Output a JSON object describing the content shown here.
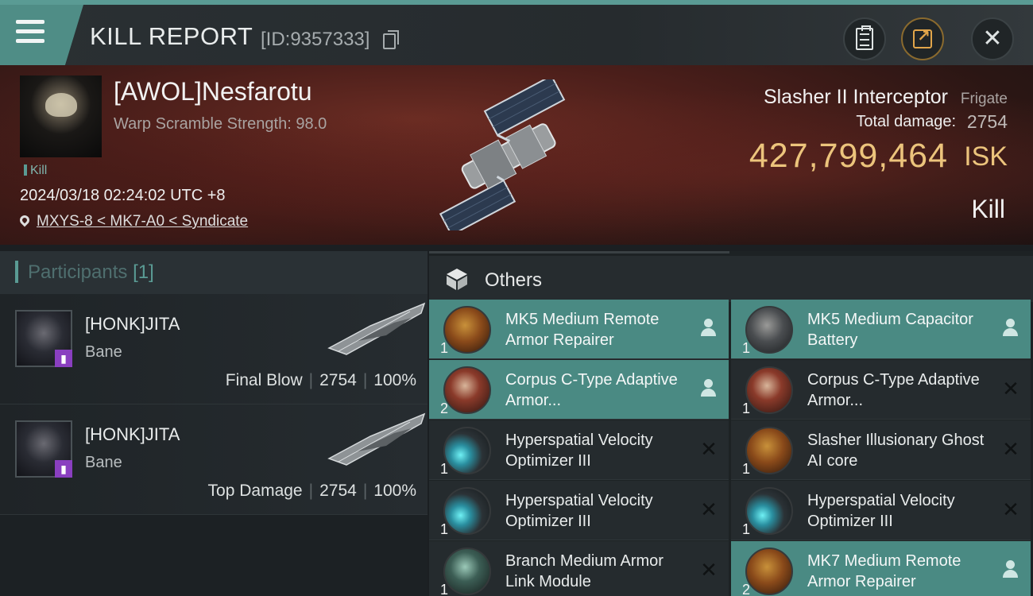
{
  "header": {
    "title": "KILL REPORT",
    "report_id": "[ID:9357333]"
  },
  "victim": {
    "name": "[AWOL]Nesfarotu",
    "scramble": "Warp Scramble Strength: 98.0",
    "tag": "Kill",
    "datetime": "2024/03/18 02:24:02 UTC +8",
    "location": "MXYS-8 < MK7-A0 < Syndicate"
  },
  "ship": {
    "name": "Slasher II Interceptor",
    "class": "Frigate",
    "damage_label": "Total damage:",
    "damage_value": "2754",
    "isk_value": "427,799,464",
    "isk_unit": "ISK",
    "result": "Kill"
  },
  "participants": {
    "label": "Participants",
    "count": "[1]",
    "rows": [
      {
        "name": "[HONK]JITA",
        "ship": "Bane",
        "role": "Final Blow",
        "damage": "2754",
        "percent": "100%"
      },
      {
        "name": "[HONK]JITA",
        "ship": "Bane",
        "role": "Top Damage",
        "damage": "2754",
        "percent": "100%"
      }
    ]
  },
  "others": {
    "label": "Others",
    "items": [
      {
        "qty": "1",
        "name": "MK5 Medium Remote Armor Repairer",
        "status": "fitted-person",
        "icon": "remote-repairer-icon"
      },
      {
        "qty": "1",
        "name": "MK5 Medium Capacitor Battery",
        "status": "fitted-person",
        "icon": "capacitor-battery-icon"
      },
      {
        "qty": "2",
        "name": "Corpus C-Type Adaptive Armor...",
        "status": "fitted-person",
        "icon": "adaptive-armor-icon"
      },
      {
        "qty": "1",
        "name": "Corpus C-Type Adaptive Armor...",
        "status": "destroyed",
        "icon": "adaptive-armor-icon"
      },
      {
        "qty": "1",
        "name": "Hyperspatial Velocity Optimizer III",
        "status": "destroyed",
        "icon": "velocity-optimizer-icon"
      },
      {
        "qty": "1",
        "name": "Slasher Illusionary Ghost AI core",
        "status": "destroyed",
        "icon": "ai-core-icon"
      },
      {
        "qty": "1",
        "name": "Hyperspatial Velocity Optimizer III",
        "status": "destroyed",
        "icon": "velocity-optimizer-icon"
      },
      {
        "qty": "1",
        "name": "Hyperspatial Velocity Optimizer III",
        "status": "destroyed",
        "icon": "velocity-optimizer-icon"
      },
      {
        "qty": "1",
        "name": "Branch Medium Armor Link Module",
        "status": "destroyed",
        "icon": "armor-link-icon"
      },
      {
        "qty": "2",
        "name": "MK7 Medium Remote Armor Repairer",
        "status": "fitted-person",
        "icon": "remote-repairer-icon"
      }
    ]
  },
  "colors": {
    "accent_teal": "#5a9b94",
    "isk_gold": "#ecc47c",
    "item_highlight": "#4a8a83"
  }
}
